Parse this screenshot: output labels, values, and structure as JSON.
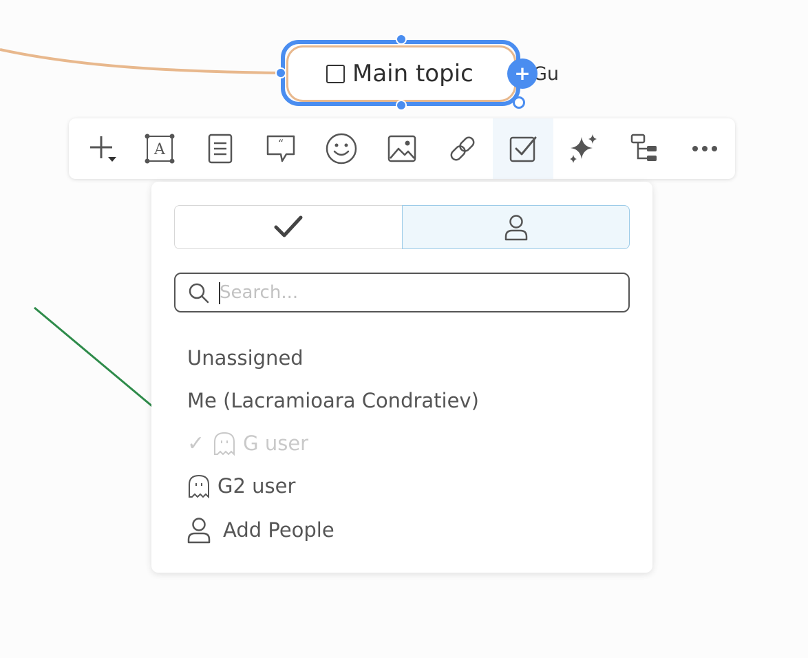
{
  "canvas": {
    "connector_color": "#e8b88d",
    "selection_color": "#4a8df0",
    "annotation_arrow_color": "#2e8b4a"
  },
  "topic": {
    "title": "Main topic",
    "add_child_label": "+",
    "side_label": "Gu",
    "checkbox_checked": false
  },
  "toolbar": {
    "tools": [
      {
        "name": "add-topic",
        "icon": "plus-dropdown-icon"
      },
      {
        "name": "text-box",
        "icon": "text-box-icon"
      },
      {
        "name": "notes",
        "icon": "note-icon"
      },
      {
        "name": "comment",
        "icon": "comment-quote-icon"
      },
      {
        "name": "emoji",
        "icon": "smiley-icon"
      },
      {
        "name": "image",
        "icon": "image-icon"
      },
      {
        "name": "link",
        "icon": "link-icon"
      },
      {
        "name": "task",
        "icon": "task-checkbox-icon",
        "active": true
      },
      {
        "name": "ai",
        "icon": "sparkles-icon"
      },
      {
        "name": "structure",
        "icon": "tree-structure-icon"
      },
      {
        "name": "more",
        "icon": "more-dots-icon"
      }
    ]
  },
  "task_panel": {
    "tabs": [
      {
        "icon": "checkmark-icon",
        "selected": false
      },
      {
        "icon": "person-icon",
        "selected": true
      }
    ],
    "search": {
      "value": "",
      "placeholder": "Search..."
    },
    "options": {
      "unassigned": "Unassigned",
      "me": "Me (Lacramioara Condratiev)",
      "g_user_check": "✓",
      "g_user": "G user",
      "g2_user": "G2 user",
      "add_people": "Add People"
    }
  }
}
